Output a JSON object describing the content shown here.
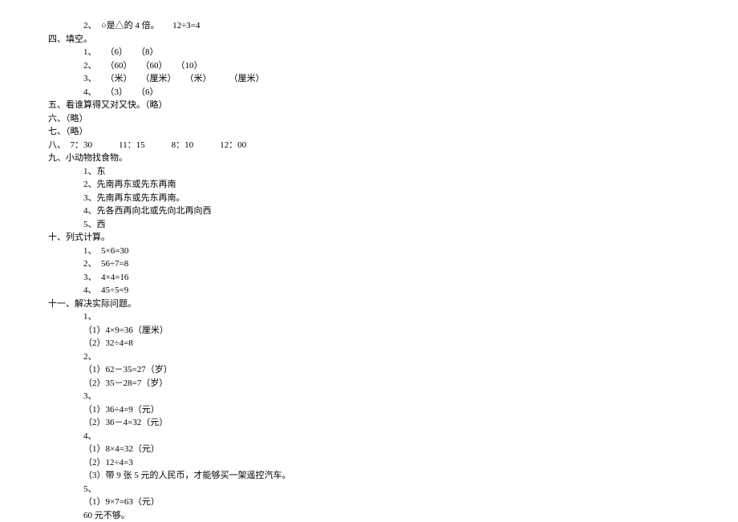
{
  "lines": [
    {
      "cls": "indent-2",
      "text": "2、　○是△的 4 倍。　　12÷3=4"
    },
    {
      "cls": "",
      "text": "四、填空。"
    },
    {
      "cls": "indent-2",
      "text": "1、　　（6）　　（8）"
    },
    {
      "cls": "indent-2",
      "text": "2、　　（60）　　（60）　　（10）"
    },
    {
      "cls": "indent-2",
      "text": "3、　　（米）　　（厘米）　　（米）　　　（厘米）"
    },
    {
      "cls": "indent-2",
      "text": "4、　　（3）　　（6）"
    },
    {
      "cls": "",
      "text": "五、看谁算得又对又快。（略）"
    },
    {
      "cls": "",
      "text": "六、（略）"
    },
    {
      "cls": "",
      "text": "七、（略）"
    },
    {
      "cls": "",
      "text": "八、　7：30　　　11：15　　　8：10　　　12：00"
    },
    {
      "cls": "",
      "text": "九、小动物找食物。"
    },
    {
      "cls": "indent-2",
      "text": "1、东"
    },
    {
      "cls": "indent-2",
      "text": "2、先南再东或先东再南"
    },
    {
      "cls": "indent-2",
      "text": "3、先南再东或先东再南。"
    },
    {
      "cls": "indent-2",
      "text": "4、先各西再向北或先向北再向西"
    },
    {
      "cls": "indent-2",
      "text": "5、西"
    },
    {
      "cls": "",
      "text": "十、列式计算。"
    },
    {
      "cls": "indent-2",
      "text": "1、　5×6=30"
    },
    {
      "cls": "indent-2",
      "text": "2、　56÷7=8"
    },
    {
      "cls": "indent-2",
      "text": "3、　4×4=16"
    },
    {
      "cls": "indent-2",
      "text": "4、　45÷5=9"
    },
    {
      "cls": "",
      "text": "十一、解决实际问题。"
    },
    {
      "cls": "indent-2",
      "text": "1、"
    },
    {
      "cls": "indent-2",
      "text": "（1）4×9=36（厘米）"
    },
    {
      "cls": "indent-2",
      "text": "（2）32÷4=8"
    },
    {
      "cls": "indent-2",
      "text": "2、"
    },
    {
      "cls": "indent-2",
      "text": "（1）62－35=27（岁）"
    },
    {
      "cls": "indent-2",
      "text": "（2）35－28=7（岁）"
    },
    {
      "cls": "indent-2",
      "text": "3、"
    },
    {
      "cls": "indent-2",
      "text": "（1）36÷4=9（元）"
    },
    {
      "cls": "indent-2",
      "text": "（2）36－4=32（元）"
    },
    {
      "cls": "indent-2",
      "text": "4、"
    },
    {
      "cls": "indent-2",
      "text": "（1）8×4=32（元）"
    },
    {
      "cls": "indent-2",
      "text": "（2）12÷4=3"
    },
    {
      "cls": "indent-2",
      "text": "（3）带 9 张 5 元的人民币，才能够买一架遥控汽车。"
    },
    {
      "cls": "indent-2",
      "text": "5、"
    },
    {
      "cls": "indent-2",
      "text": "（1）9×7=63（元）"
    },
    {
      "cls": "indent-2",
      "text": "60 元不够。"
    }
  ]
}
